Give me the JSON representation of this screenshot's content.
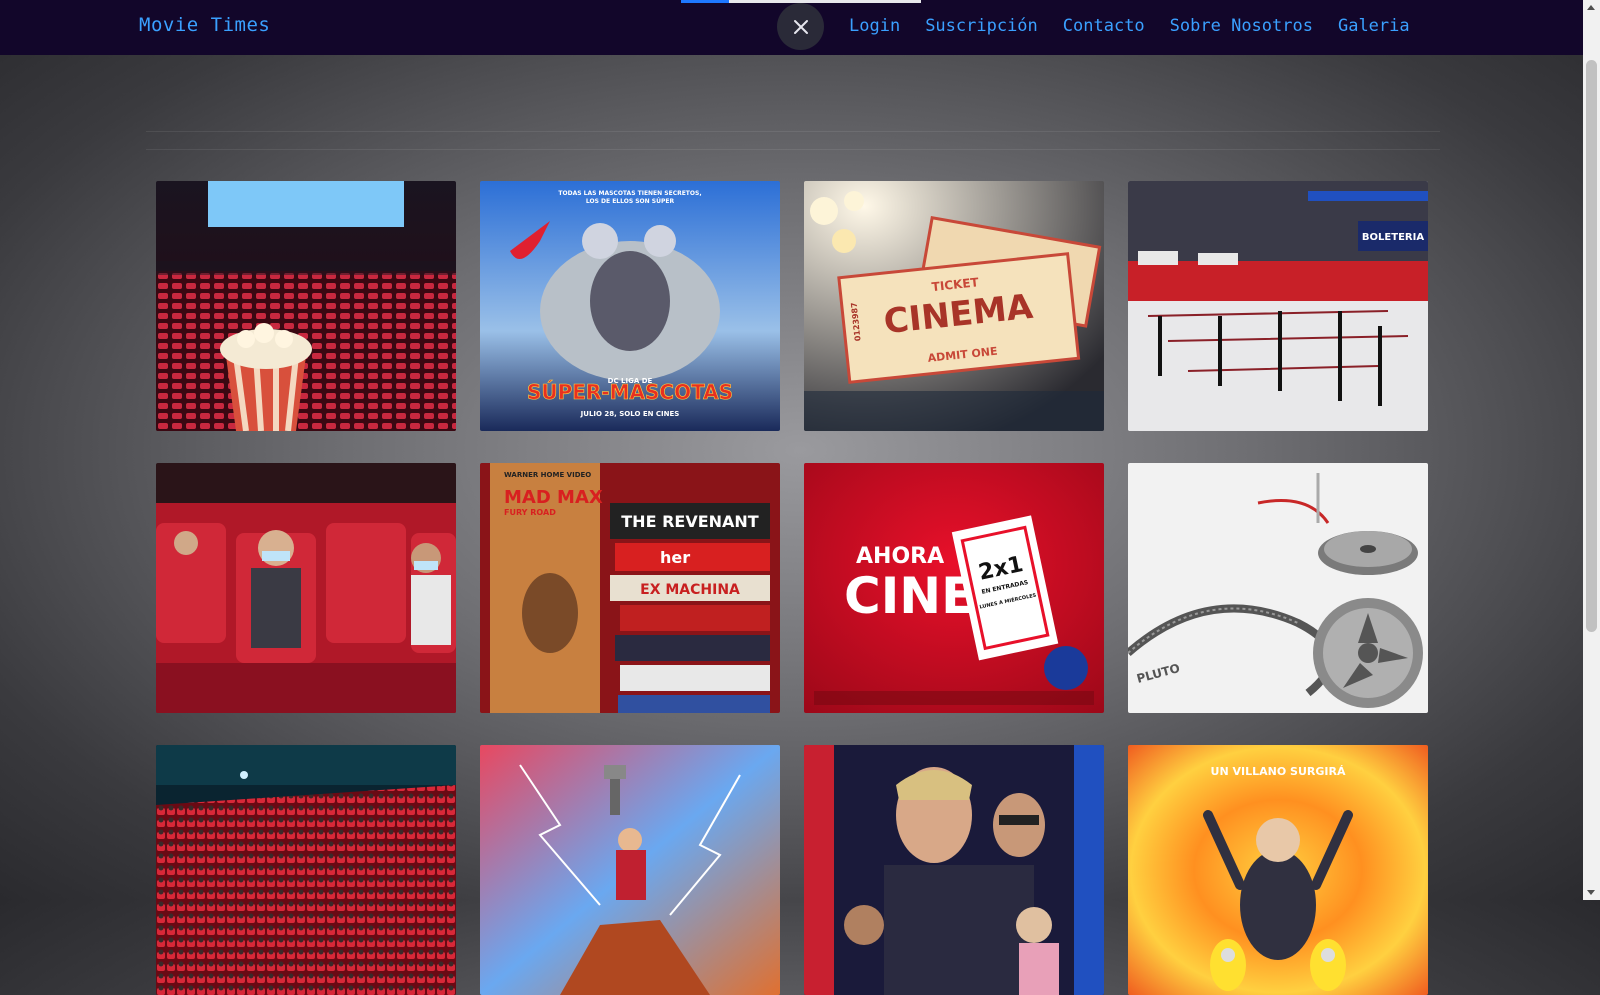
{
  "header": {
    "brand": "Movie Times",
    "nav": [
      {
        "label": "Login"
      },
      {
        "label": "Suscripción"
      },
      {
        "label": "Contacto"
      },
      {
        "label": "Sobre Nosotros"
      },
      {
        "label": "Galeria"
      }
    ],
    "close_icon": "close-icon",
    "accent": "#3aa0ff",
    "background": "#12062a"
  },
  "progress": {
    "value": 0.2
  },
  "gallery": {
    "photos": [
      {
        "name": "photo-popcorn-theater"
      },
      {
        "name": "photo-super-pets-poster",
        "texts": {
          "top": "TODAS LAS MASCOTAS TIENEN SECRETOS,",
          "top2": "LOS DE ELLOS SON SÚPER",
          "sub": "DC LIGA DE",
          "title": "SÚPER-MASCOTAS",
          "date": "JULIO 28, SOLO EN CINES"
        }
      },
      {
        "name": "photo-cinema-tickets",
        "texts": {
          "t1": "TICKET",
          "t2": "CINEMA",
          "t3": "ADMIT ONE",
          "n": "0123987"
        }
      },
      {
        "name": "photo-box-office",
        "texts": {
          "sign": "BOLETERIA"
        }
      },
      {
        "name": "photo-audience-masks"
      },
      {
        "name": "photo-dvd-stack",
        "texts": {
          "wb": "WARNER HOME VIDEO",
          "m1": "MAD MAX",
          "m2": "FURY ROAD",
          "s1": "THE REVENANT",
          "s2": "her",
          "s3": "EX MACHINA"
        }
      },
      {
        "name": "photo-ahora-cine",
        "texts": {
          "a": "AHORA",
          "c": "CINE",
          "p": "2x1",
          "p2": "EN ENTRADAS",
          "p3": "LUNES A MIÉRCOLES"
        }
      },
      {
        "name": "photo-film-reels",
        "texts": {
          "r": "PLUTO"
        }
      },
      {
        "name": "photo-red-auditorium"
      },
      {
        "name": "photo-thor-poster"
      },
      {
        "name": "photo-bullet-train-poster"
      },
      {
        "name": "photo-minions-poster",
        "texts": {
          "top": "UN VILLANO SURGIRÁ"
        }
      }
    ]
  }
}
